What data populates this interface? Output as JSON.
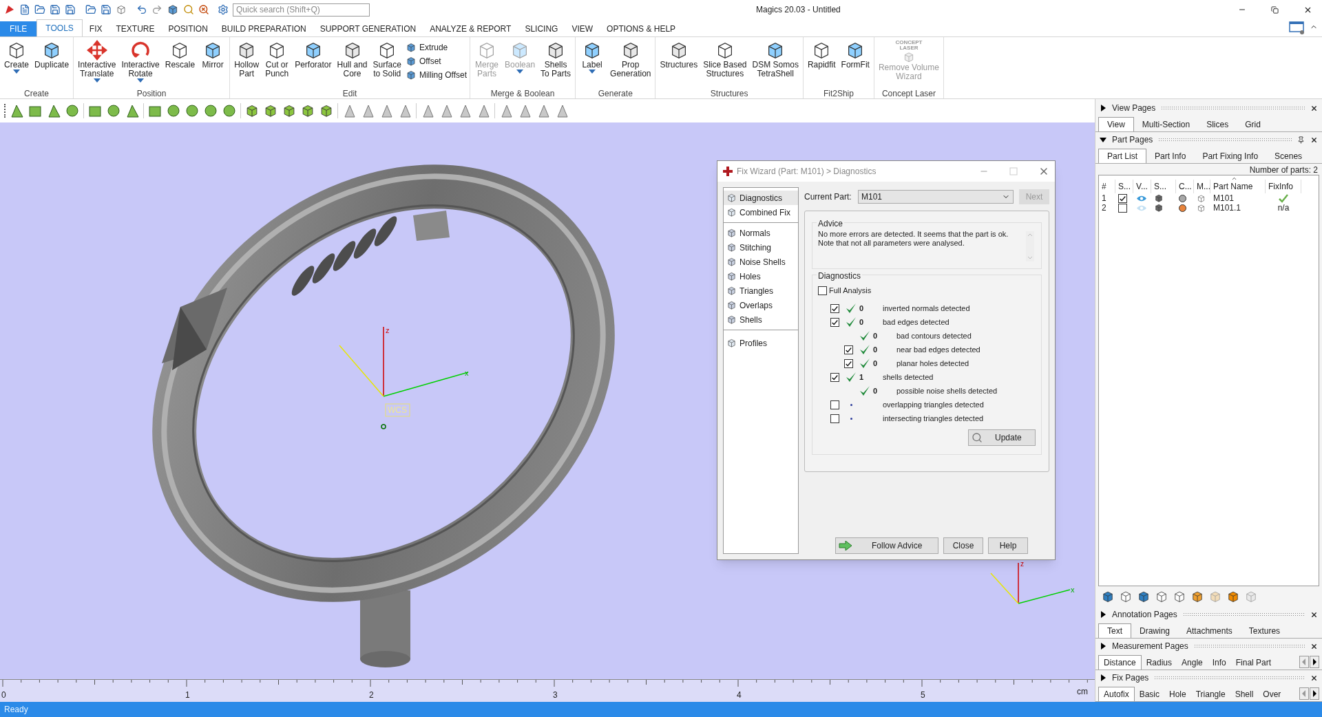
{
  "window": {
    "title": "Magics 20.03 - Untitled"
  },
  "quick_search": {
    "placeholder": "Quick search (Shift+Q)"
  },
  "ribbon_tabs": [
    {
      "label": "FILE",
      "kind": "file",
      "selected": false
    },
    {
      "label": "TOOLS",
      "kind": "tab",
      "selected": true
    },
    {
      "label": "FIX",
      "kind": "tab",
      "selected": false
    },
    {
      "label": "TEXTURE",
      "kind": "tab",
      "selected": false
    },
    {
      "label": "POSITION",
      "kind": "tab",
      "selected": false
    },
    {
      "label": "BUILD PREPARATION",
      "kind": "tab",
      "selected": false
    },
    {
      "label": "SUPPORT GENERATION",
      "kind": "tab",
      "selected": false
    },
    {
      "label": "ANALYZE & REPORT",
      "kind": "tab",
      "selected": false
    },
    {
      "label": "SLICING",
      "kind": "tab",
      "selected": false
    },
    {
      "label": "VIEW",
      "kind": "tab",
      "selected": false
    },
    {
      "label": "OPTIONS & HELP",
      "kind": "tab",
      "selected": false
    }
  ],
  "ribbon_groups": [
    {
      "label": "Create",
      "items": [
        {
          "label": "Create",
          "kind": "large",
          "dropdown": true,
          "disabled": false
        },
        {
          "label": "Duplicate",
          "kind": "large",
          "dropdown": false,
          "disabled": false
        }
      ]
    },
    {
      "label": "Position",
      "items": [
        {
          "label": "Interactive\nTranslate",
          "kind": "large",
          "dropdown": true,
          "disabled": false
        },
        {
          "label": "Interactive\nRotate",
          "kind": "large",
          "dropdown": true,
          "disabled": false
        },
        {
          "label": "Rescale",
          "kind": "large",
          "dropdown": false,
          "disabled": false
        },
        {
          "label": "Mirror",
          "kind": "large",
          "dropdown": false,
          "disabled": false
        }
      ]
    },
    {
      "label": "Edit",
      "items": [
        {
          "label": "Hollow\nPart",
          "kind": "large",
          "dropdown": false,
          "disabled": false
        },
        {
          "label": "Cut or\nPunch",
          "kind": "large",
          "dropdown": false,
          "disabled": false
        },
        {
          "label": "Perforator",
          "kind": "large",
          "dropdown": false,
          "disabled": false
        },
        {
          "label": "Hull and\nCore",
          "kind": "large",
          "dropdown": false,
          "disabled": false
        },
        {
          "label": "Surface\nto Solid",
          "kind": "large",
          "dropdown": false,
          "disabled": false
        },
        {
          "label": "Extrude",
          "kind": "small",
          "disabled": false
        },
        {
          "label": "Offset",
          "kind": "small",
          "disabled": false
        },
        {
          "label": "Milling Offset",
          "kind": "small",
          "disabled": false
        }
      ]
    },
    {
      "label": "Merge & Boolean",
      "items": [
        {
          "label": "Merge\nParts",
          "kind": "large",
          "dropdown": false,
          "disabled": true
        },
        {
          "label": "Boolean",
          "kind": "large",
          "dropdown": true,
          "disabled": true
        },
        {
          "label": "Shells\nTo Parts",
          "kind": "large",
          "dropdown": false,
          "disabled": false
        }
      ]
    },
    {
      "label": "Generate",
      "items": [
        {
          "label": "Label",
          "kind": "large",
          "dropdown": true,
          "disabled": false
        },
        {
          "label": "Prop\nGeneration",
          "kind": "large",
          "dropdown": false,
          "disabled": false
        }
      ]
    },
    {
      "label": "Structures",
      "items": [
        {
          "label": "Structures",
          "kind": "large",
          "dropdown": false,
          "disabled": false
        },
        {
          "label": "Slice Based\nStructures",
          "kind": "large",
          "dropdown": false,
          "disabled": false
        },
        {
          "label": "DSM Somos\nTetraShell",
          "kind": "large",
          "dropdown": false,
          "disabled": false
        }
      ]
    },
    {
      "label": "Fit2Ship",
      "items": [
        {
          "label": "Rapidfit",
          "kind": "large",
          "dropdown": false,
          "disabled": false
        },
        {
          "label": "FormFit",
          "kind": "large",
          "dropdown": false,
          "disabled": false
        }
      ]
    },
    {
      "label": "Concept Laser",
      "items": [
        {
          "label": "Remove Volume\nWizard",
          "kind": "large",
          "dropdown": false,
          "disabled": true,
          "logo": "CONCEPT\nLASER"
        }
      ]
    }
  ],
  "viewport": {
    "main_axes": {
      "z": "z",
      "x": "x",
      "origin": "WCS"
    },
    "corner_axes": {
      "z": "z",
      "x": "x"
    },
    "ruler": {
      "labels": [
        "0",
        "1",
        "2",
        "3",
        "4",
        "5"
      ],
      "unit": "cm"
    }
  },
  "fix_wizard": {
    "title": "Fix Wizard (Part: M101) > Diagnostics",
    "nav_groups": [
      {
        "items": [
          {
            "label": "Diagnostics",
            "selected": true
          },
          {
            "label": "Combined Fix",
            "selected": false
          }
        ]
      },
      {
        "items": [
          {
            "label": "Normals",
            "selected": false
          },
          {
            "label": "Stitching",
            "selected": false
          },
          {
            "label": "Noise Shells",
            "selected": false
          },
          {
            "label": "Holes",
            "selected": false
          },
          {
            "label": "Triangles",
            "selected": false
          },
          {
            "label": "Overlaps",
            "selected": false
          },
          {
            "label": "Shells",
            "selected": false
          }
        ]
      },
      {
        "items": [
          {
            "label": "Profiles",
            "selected": false
          }
        ]
      }
    ],
    "current_part_label": "Current Part:",
    "current_part": "M101",
    "next_button": {
      "label": "Next",
      "disabled": true
    },
    "advice": {
      "title": "Advice",
      "text": "No more errors are detected. It seems that the part is ok.\nNote that not all parameters were analysed."
    },
    "diagnostics": {
      "title": "Diagnostics",
      "full_analysis": {
        "label": "Full Analysis",
        "checked": false
      },
      "rows": [
        {
          "kind": "checkbox",
          "checked": true,
          "passed": true,
          "count": "0",
          "label": "inverted normals detected"
        },
        {
          "kind": "checkbox",
          "checked": true,
          "passed": true,
          "count": "0",
          "label": "bad edges detected",
          "children": [
            {
              "kind": "plain",
              "passed": true,
              "count": "0",
              "label": "bad contours detected"
            },
            {
              "kind": "checkbox",
              "checked": true,
              "passed": true,
              "count": "0",
              "label": "near bad edges detected"
            },
            {
              "kind": "checkbox",
              "checked": true,
              "passed": true,
              "count": "0",
              "label": "planar holes detected"
            }
          ]
        },
        {
          "kind": "checkbox",
          "checked": true,
          "passed": true,
          "count": "1",
          "label": "shells detected",
          "children": [
            {
              "kind": "plain",
              "passed": true,
              "count": "0",
              "label": "possible noise shells detected"
            }
          ]
        },
        {
          "kind": "checkbox",
          "checked": false,
          "passed": false,
          "label": "overlapping triangles detected"
        },
        {
          "kind": "checkbox",
          "checked": false,
          "passed": false,
          "label": "intersecting triangles detected"
        }
      ]
    },
    "update_button": "Update",
    "buttons": [
      "Follow Advice",
      "Close",
      "Help"
    ]
  },
  "panel": {
    "sections": [
      {
        "kind": "tabs",
        "title": "View Pages",
        "expanded": false,
        "tabs": [
          {
            "label": "View",
            "selected": true
          },
          {
            "label": "Multi-Section",
            "selected": false
          },
          {
            "label": "Slices",
            "selected": false
          },
          {
            "label": "Grid",
            "selected": false
          }
        ]
      },
      {
        "kind": "part_list",
        "title": "Part Pages",
        "expanded": true,
        "tabs": [
          {
            "label": "Part List",
            "selected": true
          },
          {
            "label": "Part Info",
            "selected": false
          },
          {
            "label": "Part Fixing Info",
            "selected": false
          },
          {
            "label": "Scenes",
            "selected": false
          }
        ],
        "parts_count": "Number of parts: 2",
        "columns": [
          "#",
          "S...",
          "V...",
          "S...",
          "C...",
          "M...",
          "Part Name",
          "FixInfo"
        ],
        "rows": [
          {
            "number": "1",
            "checked": true,
            "visible": true,
            "color": "#a8a8a8",
            "name": "M101",
            "fix_ok": true
          },
          {
            "number": "2",
            "checked": false,
            "visible": false,
            "color": "#e8843c",
            "name": "M101.1",
            "fix_ok": false,
            "fix_info": "n/a"
          }
        ]
      },
      {
        "kind": "tabs",
        "title": "Annotation Pages",
        "expanded": false,
        "tabs": [
          {
            "label": "Text",
            "selected": true
          },
          {
            "label": "Drawing",
            "selected": false
          },
          {
            "label": "Attachments",
            "selected": false
          },
          {
            "label": "Textures",
            "selected": false
          }
        ]
      },
      {
        "kind": "tabs",
        "title": "Measurement Pages",
        "expanded": false,
        "overflow": true,
        "tabs": [
          {
            "label": "Distance",
            "selected": true
          },
          {
            "label": "Radius",
            "selected": false
          },
          {
            "label": "Angle",
            "selected": false
          },
          {
            "label": "Info",
            "selected": false
          },
          {
            "label": "Final Part",
            "selected": false
          }
        ]
      },
      {
        "kind": "tabs",
        "title": "Fix Pages",
        "expanded": false,
        "overflow": true,
        "tabs": [
          {
            "label": "Autofix",
            "selected": true
          },
          {
            "label": "Basic",
            "selected": false
          },
          {
            "label": "Hole",
            "selected": false
          },
          {
            "label": "Triangle",
            "selected": false
          },
          {
            "label": "Shell",
            "selected": false
          },
          {
            "label": "Over",
            "selected": false
          }
        ]
      }
    ]
  },
  "status_bar": {
    "text": "Ready"
  }
}
